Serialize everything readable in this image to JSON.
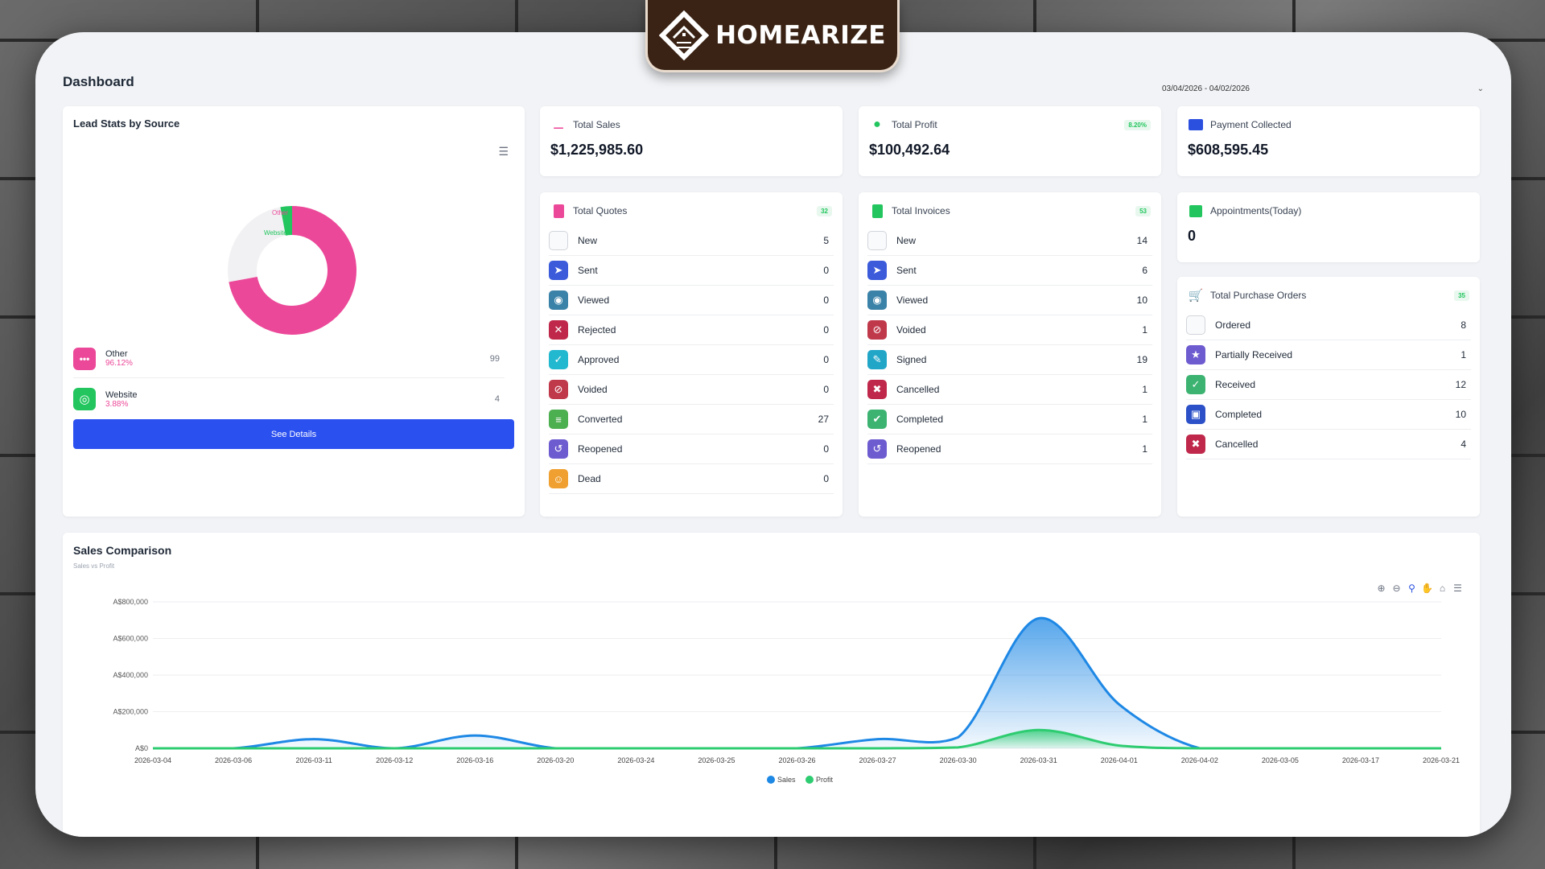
{
  "brand": {
    "name": "HOMEARIZE"
  },
  "page": {
    "title": "Dashboard",
    "date_range": "03/04/2026 - 04/02/2026"
  },
  "lead_stats": {
    "title": "Lead Stats by Source",
    "items": [
      {
        "name": "Other",
        "percent": "96.12%",
        "count": "99",
        "value": 99,
        "color": "#ec4899"
      },
      {
        "name": "Website",
        "percent": "3.88%",
        "count": "4",
        "value": 4,
        "color": "#22c55e"
      }
    ],
    "button": "See Details"
  },
  "stats": {
    "sales": {
      "label": "Total Sales",
      "value": "$1,225,985.60"
    },
    "profit": {
      "label": "Total Profit",
      "value": "$100,492.64",
      "badge": "8.20%"
    },
    "payment": {
      "label": "Payment Collected",
      "value": "$608,595.45"
    },
    "appointments": {
      "label": "Appointments(Today)",
      "value": "0"
    }
  },
  "quotes": {
    "title": "Total Quotes",
    "badge": "32",
    "rows": [
      {
        "label": "New",
        "count": "5",
        "icon": "file-icon",
        "color": "#e5e7eb"
      },
      {
        "label": "Sent",
        "count": "0",
        "icon": "paper-plane-icon",
        "color": "#3b5bdb"
      },
      {
        "label": "Viewed",
        "count": "0",
        "icon": "eye-icon",
        "color": "#3b82a8"
      },
      {
        "label": "Rejected",
        "count": "0",
        "icon": "close-circle-icon",
        "color": "#c0284b"
      },
      {
        "label": "Approved",
        "count": "0",
        "icon": "check-circle-icon",
        "color": "#22b8cf"
      },
      {
        "label": "Voided",
        "count": "0",
        "icon": "ban-icon",
        "color": "#c0394b"
      },
      {
        "label": "Converted",
        "count": "27",
        "icon": "document-icon",
        "color": "#4caf50"
      },
      {
        "label": "Reopened",
        "count": "0",
        "icon": "undo-icon",
        "color": "#6d5bd0"
      },
      {
        "label": "Dead",
        "count": "0",
        "icon": "skull-icon",
        "color": "#f0a030"
      }
    ]
  },
  "invoices": {
    "title": "Total Invoices",
    "badge": "53",
    "rows": [
      {
        "label": "New",
        "count": "14",
        "icon": "file-icon",
        "color": "#e5e7eb"
      },
      {
        "label": "Sent",
        "count": "6",
        "icon": "paper-plane-icon",
        "color": "#3b5bdb"
      },
      {
        "label": "Viewed",
        "count": "10",
        "icon": "eye-icon",
        "color": "#3b82a8"
      },
      {
        "label": "Voided",
        "count": "1",
        "icon": "ban-icon",
        "color": "#c0394b"
      },
      {
        "label": "Signed",
        "count": "19",
        "icon": "signature-icon",
        "color": "#22a6c8"
      },
      {
        "label": "Cancelled",
        "count": "1",
        "icon": "close-icon",
        "color": "#c0284b"
      },
      {
        "label": "Completed",
        "count": "1",
        "icon": "check-icon",
        "color": "#3cb371"
      },
      {
        "label": "Reopened",
        "count": "1",
        "icon": "undo-icon",
        "color": "#6d5bd0"
      }
    ]
  },
  "purchase_orders": {
    "title": "Total Purchase Orders",
    "badge": "35",
    "rows": [
      {
        "label": "Ordered",
        "count": "8",
        "icon": "file-icon",
        "color": "#e5e7eb"
      },
      {
        "label": "Partially Received",
        "count": "1",
        "icon": "star-icon",
        "color": "#6d5bd0"
      },
      {
        "label": "Received",
        "count": "12",
        "icon": "check-circle-icon",
        "color": "#3cb371"
      },
      {
        "label": "Completed",
        "count": "10",
        "icon": "clipboard-icon",
        "color": "#2b50c8"
      },
      {
        "label": "Cancelled",
        "count": "4",
        "icon": "close-icon",
        "color": "#c0284b"
      }
    ]
  },
  "sales_comparison": {
    "title": "Sales Comparison",
    "subtitle": "Sales vs Profit"
  },
  "chart_data": {
    "type": "area",
    "title": "Sales Comparison",
    "subtitle": "Sales vs Profit",
    "categories": [
      "2026-03-04",
      "2026-03-06",
      "2026-03-11",
      "2026-03-12",
      "2026-03-16",
      "2026-03-20",
      "2026-03-24",
      "2026-03-25",
      "2026-03-26",
      "2026-03-27",
      "2026-03-30",
      "2026-03-31",
      "2026-04-01",
      "2026-04-02",
      "2026-03-05",
      "2026-03-17",
      "2026-03-21"
    ],
    "series": [
      {
        "name": "Sales",
        "color": "#1e88e5",
        "values": [
          0,
          0,
          50000,
          0,
          70000,
          0,
          0,
          0,
          0,
          50000,
          60000,
          710000,
          240000,
          0,
          0,
          0,
          0
        ]
      },
      {
        "name": "Profit",
        "color": "#2ecc71",
        "values": [
          0,
          0,
          0,
          0,
          0,
          0,
          0,
          0,
          0,
          0,
          5000,
          100000,
          15000,
          0,
          0,
          0,
          0
        ]
      }
    ],
    "ylim": [
      0,
      800000
    ],
    "yticks": [
      "A$0",
      "A$200,000",
      "A$400,000",
      "A$600,000",
      "A$800,000"
    ],
    "legend": "bottom-center",
    "grid": true
  }
}
